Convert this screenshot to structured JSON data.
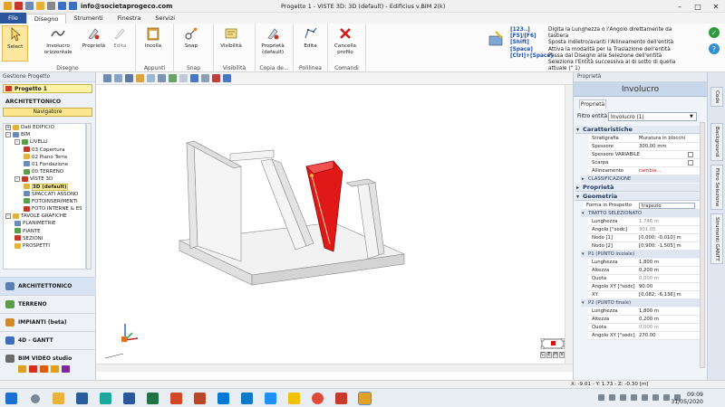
{
  "titlebar": {
    "email": "info@societaprogeco.com",
    "title": "Progetto 1 -  VISTE 3D: 3D (default) - Edificius v.BIM 2(k)"
  },
  "tabs": [
    {
      "label": "File"
    },
    {
      "label": "Disegno"
    },
    {
      "label": "Strumenti"
    },
    {
      "label": "Finestra"
    },
    {
      "label": "Servizi"
    }
  ],
  "ribbon": {
    "select": "Select",
    "involucro": "Involucro orizzontale",
    "proprieta": "Proprietà",
    "edita": "Edita",
    "incolla": "Incolla",
    "snap": "Snap",
    "visibilita": "Visibilità",
    "proprieta_default": "Proprietà (default)",
    "edita2": "Edita",
    "cancella": "Cancella profilo",
    "groups": {
      "disegno": "Disegno",
      "appunti": "Appunti",
      "snap": "Snap",
      "visibilita": "Visibilità",
      "copia": "Copia de...",
      "polilinea": "Polilinea",
      "comandi": "Comandi"
    }
  },
  "help": {
    "keys": [
      "[123..]",
      "[F5]/[F6]",
      "[Shift]",
      "[Space]",
      "[Ctrl]+[Space]"
    ],
    "lines": [
      "Digita la Lunghezza o l'Angolo direttamente da tastiera",
      "Sposta indietro/avanti l'Allineamento dell'entità",
      "Attiva la modalità per la Traslazione dell'entità",
      "Passa dal Disegno alla Selezione dell'entità",
      "Seleziona l'Entità successiva al di sotto di quella attuale (\" 1)"
    ]
  },
  "left": {
    "panel_title": "Gestione Progetto",
    "project": "Progetto 1",
    "section": "ARCHITETTONICO",
    "navigator": "Navigatore",
    "tree": [
      {
        "label": "Dati EDIFICIO",
        "level": 0,
        "box": "+"
      },
      {
        "label": "BIM",
        "level": 0,
        "box": "-"
      },
      {
        "label": "LIVELLI",
        "level": 1,
        "box": "-"
      },
      {
        "label": "03 Copertura",
        "level": 2
      },
      {
        "label": "02 Piano Terra",
        "level": 2
      },
      {
        "label": "01 Fondazione",
        "level": 2
      },
      {
        "label": "00 TERRENO",
        "level": 2
      },
      {
        "label": "VISTE 3D",
        "level": 1,
        "box": "-"
      },
      {
        "label": "3D (default)",
        "level": 2,
        "selected": true
      },
      {
        "label": "SPACCATI ASSONO",
        "level": 2
      },
      {
        "label": "FOTOINSERIMENTI",
        "level": 2
      },
      {
        "label": "FOTO INTERNE & ES",
        "level": 2
      },
      {
        "label": "TAVOLE GRAFICHE",
        "level": 0,
        "box": "-"
      },
      {
        "label": "PLANIMETRIE",
        "level": 1
      },
      {
        "label": "PIANTE",
        "level": 1
      },
      {
        "label": "SEZIONI",
        "level": 1
      },
      {
        "label": "PROSPETTI",
        "level": 1
      }
    ],
    "modules": [
      {
        "label": "ARCHITETTONICO",
        "active": true
      },
      {
        "label": "TERRENO"
      },
      {
        "label": "IMPIANTI  (beta)"
      },
      {
        "label": "4D - GANTT"
      },
      {
        "label": "BIM VIDEO studio"
      }
    ]
  },
  "viewport": {
    "viewcube_letters": [
      "C",
      "E",
      "H",
      "V"
    ]
  },
  "right": {
    "panel_title": "Proprietà",
    "entity": "Involucro",
    "tab": "Proprietà",
    "filter_label": "Filtro entità",
    "filter_value": "Involucro (1)",
    "sections": {
      "caratteristiche": "Caratteristiche",
      "proprieta": "Proprietà",
      "geometria": "Geometria"
    },
    "caratteristiche": [
      {
        "k": "Stratigrafia",
        "v": "Muratura in blocchi"
      },
      {
        "k": "Spessore",
        "v": "300,00 mm"
      },
      {
        "k": "Spessore VARIABILE",
        "v": ""
      },
      {
        "k": "Scarpa",
        "v": ""
      },
      {
        "k": "Allineamento",
        "v": "cambia..."
      }
    ],
    "classificazione": "CLASSIFICAZIONE",
    "forma_label": "Forma in Prospetto",
    "forma_value": "trapezio",
    "tratto": {
      "title": "TRATTO SELEZIONATO",
      "rows": [
        {
          "k": "Lunghezza",
          "v": "1,746 m"
        },
        {
          "k": "Angolo  [°sodc]",
          "v": "301.05"
        },
        {
          "k": "Nodo [1]",
          "v": "[0,000; -0,010] m"
        },
        {
          "k": "Nodo [2]",
          "v": "[0,900; -1,505] m"
        }
      ]
    },
    "p1": {
      "title": "P1 (PUNTO iniziale)",
      "rows": [
        {
          "k": "Lunghezza",
          "v": "1,800 m"
        },
        {
          "k": "Altezza",
          "v": "0,200 m"
        },
        {
          "k": "Quota",
          "v": "0,000 m"
        },
        {
          "k": "Angolo XY  [°sodc]",
          "v": "90.00"
        },
        {
          "k": "XY",
          "v": "[0,082; -6,136] m"
        }
      ]
    },
    "p2": {
      "title": "P2 (PUNTO finale)",
      "rows": [
        {
          "k": "Lunghezza",
          "v": "1,800 m"
        },
        {
          "k": "Altezza",
          "v": "0,200 m"
        },
        {
          "k": "Quota",
          "v": "0,000 m"
        },
        {
          "k": "Angolo XY  [°sodc]",
          "v": "270.00"
        }
      ]
    }
  },
  "vtabs": [
    "Code",
    "Background",
    "Filtro Selezione",
    "Strumenti GANTT"
  ],
  "status": {
    "coords": "X: -9.01 - Y: 1.73 - Z: -0.30 [m]"
  },
  "clock": {
    "time": "09:09",
    "date": "31/05/2020"
  },
  "colors": {
    "accent": "#2b579a",
    "selected": "#e01010",
    "highlight": "#fff0a0"
  }
}
